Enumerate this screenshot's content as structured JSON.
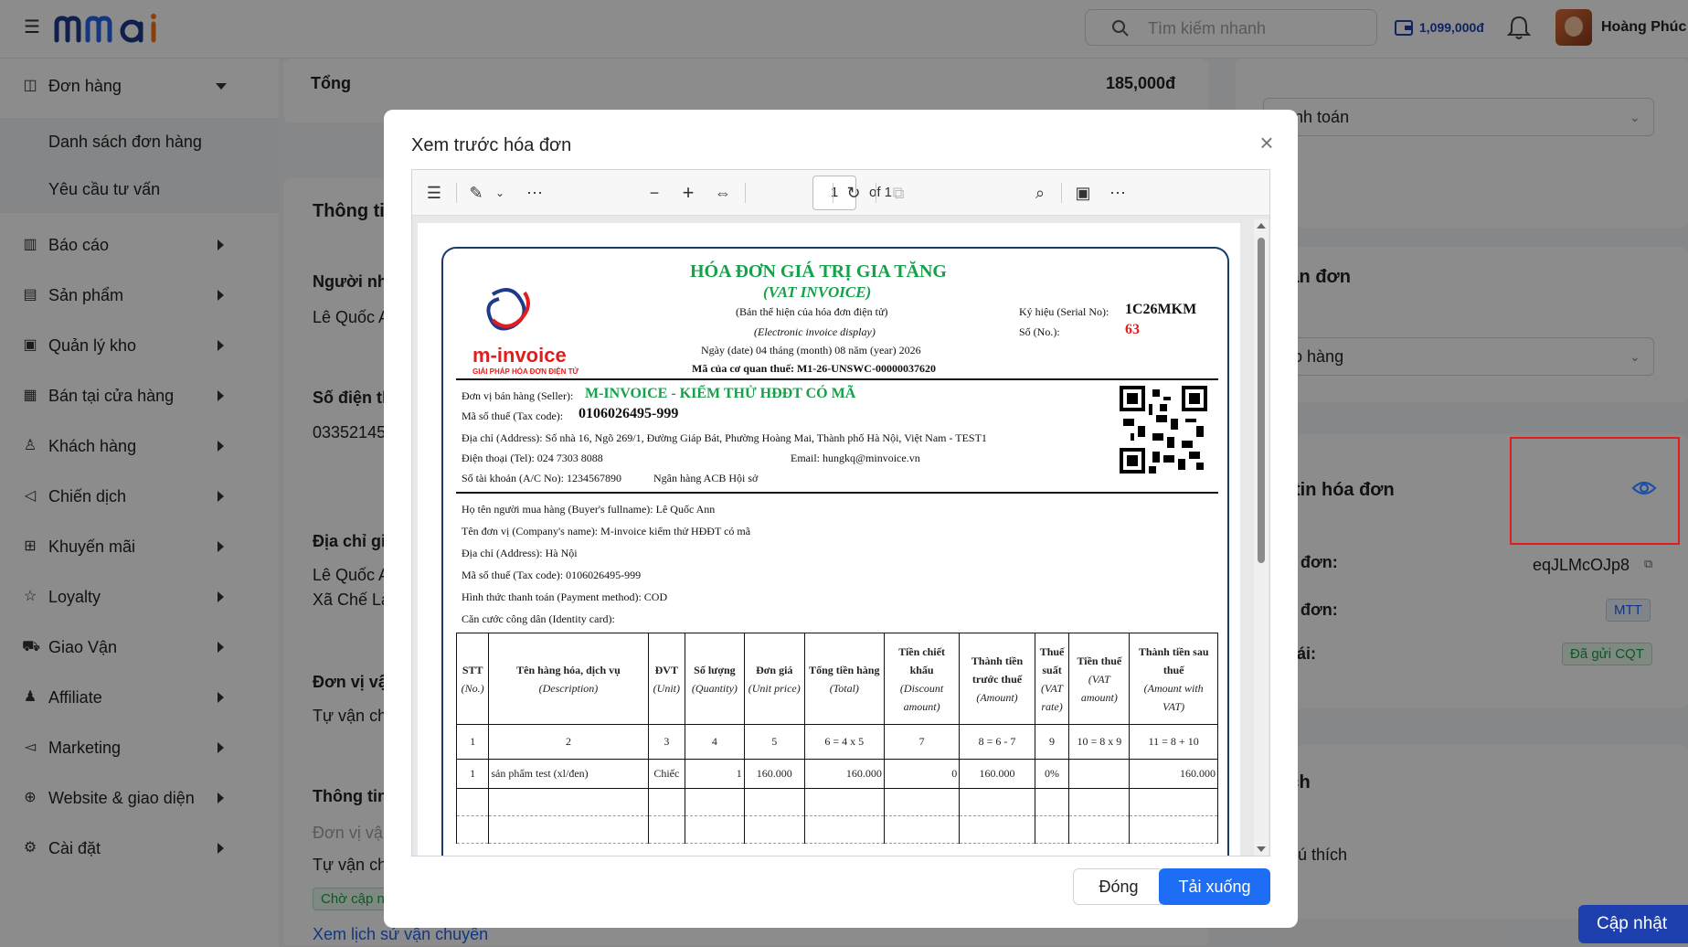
{
  "header": {
    "logo_text": "mmai",
    "search_placeholder": "Tìm kiếm nhanh",
    "wallet": "1,099,000đ",
    "user_name": "Hoàng Phúc"
  },
  "sidebar": {
    "items": [
      {
        "label": "Đơn hàng",
        "icon": "bag-icon"
      },
      {
        "label": "Báo cáo",
        "icon": "chart-icon"
      },
      {
        "label": "Sản phẩm",
        "icon": "box-icon"
      },
      {
        "label": "Quản lý kho",
        "icon": "warehouse-icon"
      },
      {
        "label": "Bán tại cửa hàng",
        "icon": "store-icon"
      },
      {
        "label": "Khách hàng",
        "icon": "users-icon"
      },
      {
        "label": "Chiến dịch",
        "icon": "megaphone-icon"
      },
      {
        "label": "Khuyến mãi",
        "icon": "gift-icon"
      },
      {
        "label": "Loyalty",
        "icon": "star-icon"
      },
      {
        "label": "Giao Vận",
        "icon": "truck-icon"
      },
      {
        "label": "Affiliate",
        "icon": "affiliate-icon"
      },
      {
        "label": "Marketing",
        "icon": "marketing-icon"
      },
      {
        "label": "Website & giao diện",
        "icon": "globe-icon"
      },
      {
        "label": "Cài đặt",
        "icon": "settings-icon"
      }
    ],
    "sub_items": [
      "Danh sách đơn hàng",
      "Yêu cầu tư vấn"
    ]
  },
  "main": {
    "total_label": "Tổng",
    "total_value": "185,000đ",
    "info_title": "Thông ti",
    "receiver_label": "Người nh",
    "receiver_value": "Lê Quốc A",
    "phone_label": "Số điện th",
    "phone_value": "03352145",
    "address_label": "Địa chỉ gi",
    "address_line1": "Lê Quốc A",
    "address_line2": "Xã Chế Là",
    "unit_label": "Đơn vị vậ",
    "unit_value": "Tự vận ch",
    "ship_title": "Thông tin",
    "ship_unit_label": "Đơn vị vậ",
    "ship_unit_value": "Tự vận ch",
    "ship_status": "Chờ cập n",
    "history_link": "Xem lịch sử vận chuyển"
  },
  "right": {
    "payment_select": "thanh toán",
    "receive_title": "nhận đơn",
    "delivery_select": "giao hàng",
    "invoice_title": "ng tin hóa đơn",
    "invoice_code_label": "hóa đơn:",
    "invoice_code_value": "eqJLMcOJp8",
    "invoice_type_label": "hóa đơn:",
    "invoice_type_value": "MTT",
    "status_label": "g thái:",
    "status_value": "Đã gửi CQT",
    "note_title": "thích",
    "note_placeholder": "g chú thích",
    "update_button": "Cập nhật"
  },
  "modal": {
    "title": "Xem trước hóa đơn",
    "page_current": "1",
    "page_of": "of 1",
    "close_button": "Đóng",
    "download_button": "Tải xuống"
  },
  "invoice": {
    "title": "HÓA ĐƠN GIÁ TRỊ GIA TĂNG",
    "title_en": "(VAT INVOICE)",
    "display_vn": "(Bản thể hiện của hóa đơn điện tử)",
    "display_en": "(Electronic invoice display)",
    "date_line": "Ngày (date) 04 tháng (month) 08 năm (year) 2026",
    "cqt_code": "Mã của cơ quan thuế: M1-26-UNSWC-00000037620",
    "serial_label": "Ký hiệu (Serial No):",
    "serial_value": "1C26MKM",
    "no_label": "Số (No.):",
    "no_value": "63",
    "logo_text": "m-invoice",
    "logo_sub": "GIẢI PHÁP HÓA ĐƠN ĐIỆN TỬ",
    "seller_label": "Đơn vị bán hàng (Seller):",
    "seller_value": "M-INVOICE - KIỂM THỬ HĐĐT CÓ MÃ",
    "seller_tax_label": "Mã số thuế (Tax code):",
    "seller_tax_value": "0106026495-999",
    "seller_address": "Địa chỉ (Address): Số nhà 16, Ngõ 269/1, Đường Giáp Bát, Phường Hoàng Mai, Thành phố Hà Nội, Việt Nam - TEST1",
    "seller_tel": "Điện thoại (Tel): 024 7303 8088",
    "seller_email": "Email: hungkq@minvoice.vn",
    "seller_account": "Số tài khoản (A/C No): 1234567890",
    "seller_bank": "Ngân hàng ACB Hội sở",
    "buyer_name": "Họ tên người mua hàng (Buyer's fullname): Lê Quốc Ann",
    "buyer_company": "Tên đơn vị (Company's name): M-invoice kiểm thử HĐĐT có mã",
    "buyer_address": "Địa chỉ (Address): Hà Nội",
    "buyer_tax": "Mã số thuế (Tax code): 0106026495-999",
    "payment_method": "Hình thức thanh toán (Payment method): COD",
    "identity": "Căn cước công dân (Identity card):",
    "table": {
      "headers": [
        {
          "vn": "STT",
          "en": "(No.)"
        },
        {
          "vn": "Tên hàng hóa, dịch vụ",
          "en": "(Description)"
        },
        {
          "vn": "ĐVT",
          "en": "(Unit)"
        },
        {
          "vn": "Số lượng",
          "en": "(Quantity)"
        },
        {
          "vn": "Đơn giá",
          "en": "(Unit price)"
        },
        {
          "vn": "Tổng tiền hàng",
          "en": "(Total)"
        },
        {
          "vn": "Tiền chiết khấu",
          "en": "(Discount amount)"
        },
        {
          "vn": "Thành tiền trước thuế",
          "en": "(Amount)"
        },
        {
          "vn": "Thuế suất",
          "en": "(VAT rate)"
        },
        {
          "vn": "Tiền thuế",
          "en": "(VAT amount)"
        },
        {
          "vn": "Thành tiền sau thuế",
          "en": "(Amount with VAT)"
        }
      ],
      "formula_row": [
        "1",
        "2",
        "3",
        "4",
        "5",
        "6 = 4 x 5",
        "7",
        "8 = 6 - 7",
        "9",
        "10 = 8 x 9",
        "11 = 8 + 10"
      ],
      "rows": [
        [
          "1",
          "sản phẩm test (xl/đen)",
          "Chiếc",
          "1",
          "160.000",
          "160.000",
          "0",
          "160.000",
          "0%",
          "",
          "160.000"
        ]
      ]
    }
  },
  "colors": {
    "primary": "#1d6ef5",
    "invoice_green": "#15a04a",
    "invoice_red": "#e11d1d",
    "highlight": "#e11d1d"
  }
}
